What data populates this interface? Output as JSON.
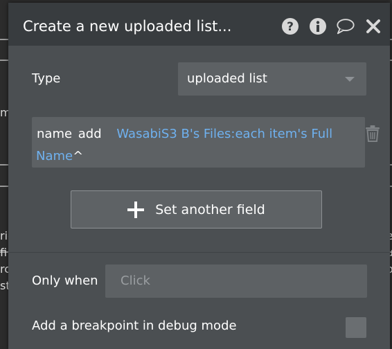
{
  "dialog": {
    "title": "Create a new uploaded list...",
    "icons": [
      "help-icon",
      "info-icon",
      "comment-icon",
      "close-icon"
    ]
  },
  "type_row": {
    "label": "Type",
    "selected": "uploaded list"
  },
  "field_row": {
    "key": "name",
    "operator": "add",
    "expression_line1": "WasabiS3 B's Files:each item's Full",
    "expression_line2": "Name",
    "caret": "^"
  },
  "set_field_button": {
    "label": "Set another field"
  },
  "only_when": {
    "label": "Only when",
    "placeholder": "Click"
  },
  "breakpoint": {
    "label": "Add a breakpoint in debug mode"
  },
  "background_fragments": [
    "m",
    "rio",
    "fi",
    "rc",
    "st",
    "e",
    "u",
    "o"
  ],
  "colors": {
    "expression": "#6fb1ef",
    "dialog_bg": "#4b4f52",
    "titlebar_bg": "#383c3f"
  }
}
